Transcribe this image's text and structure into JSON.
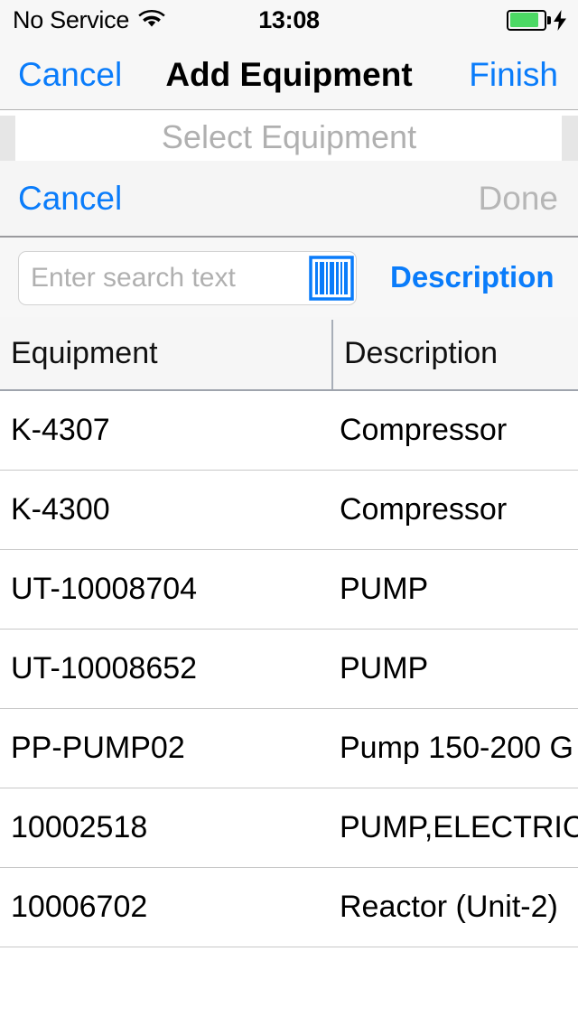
{
  "status_bar": {
    "carrier": "No Service",
    "time": "13:08",
    "wifi_icon": "wifi-icon",
    "battery_icon": "battery-icon",
    "charging_icon": "lightning-bolt-icon",
    "battery_color": "#4CD964",
    "battery_level_percent": 80
  },
  "nav_bar": {
    "left_button": "Cancel",
    "title": "Add Equipment",
    "right_button": "Finish",
    "accent_color": "#0a7cfa"
  },
  "picker": {
    "selected_value": "Select Equipment",
    "cancel_label": "Cancel",
    "done_label": "Done",
    "done_enabled": false
  },
  "search": {
    "placeholder": "Enter search text",
    "value": "",
    "barcode_icon": "barcode-scan-icon",
    "filter_link": "Description"
  },
  "table": {
    "columns": [
      "Equipment",
      "Description"
    ],
    "rows": [
      {
        "equipment": "K-4307",
        "description": "Compressor"
      },
      {
        "equipment": "K-4300",
        "description": "Compressor"
      },
      {
        "equipment": "UT-10008704",
        "description": "PUMP"
      },
      {
        "equipment": "UT-10008652",
        "description": "PUMP"
      },
      {
        "equipment": "PP-PUMP02",
        "description": "Pump 150-200 G"
      },
      {
        "equipment": "10002518",
        "description": "PUMP,ELECTRIC"
      },
      {
        "equipment": "10006702",
        "description": "Reactor (Unit-2)"
      }
    ]
  }
}
